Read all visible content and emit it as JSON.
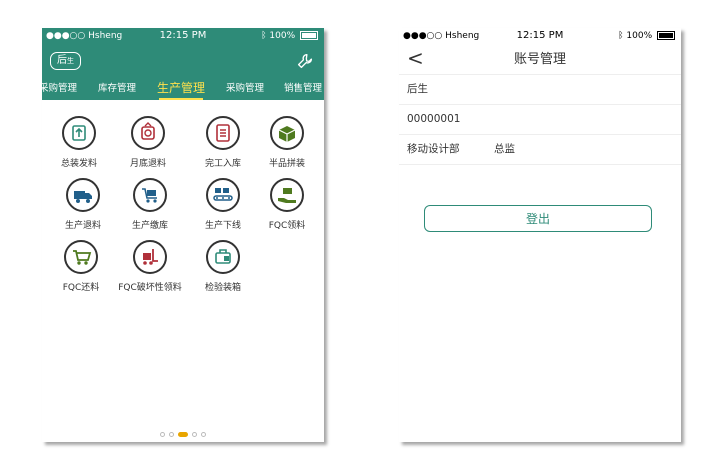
{
  "left": {
    "status": {
      "carrier": "●●●○○ Hsheng",
      "time": "12:15 PM",
      "battery": "100%"
    },
    "user_pill": {
      "main": "后",
      "sub": "生"
    },
    "tabs": [
      "采购管理",
      "库存管理",
      "生产管理",
      "采购管理",
      "销售管理"
    ],
    "active_tab": "生产管理",
    "grid": [
      {
        "label": "总装发料",
        "icon": "upload-box-icon"
      },
      {
        "label": "月底退料",
        "icon": "return-material-icon"
      },
      {
        "label": "完工入库",
        "icon": "clipboard-list-icon"
      },
      {
        "label": "半品拼装",
        "icon": "open-box-icon"
      },
      {
        "label": "生产退料",
        "icon": "truck-icon"
      },
      {
        "label": "生产缴库",
        "icon": "cart-icon"
      },
      {
        "label": "生产下线",
        "icon": "conveyor-icon"
      },
      {
        "label": "FQC领料",
        "icon": "hand-receive-icon"
      },
      {
        "label": "FQC还料",
        "icon": "cart-return-icon"
      },
      {
        "label": "FQC破坏性领料",
        "icon": "forklift-icon"
      },
      {
        "label": "检验装箱",
        "icon": "package-check-icon"
      }
    ],
    "pager": {
      "count": 5,
      "active": 2
    }
  },
  "right": {
    "status": {
      "carrier": "●●●○○ Hsheng",
      "time": "12:15 PM",
      "battery": "100%"
    },
    "title": "账号管理",
    "name": "后生",
    "id": "00000001",
    "department": "移动设计部",
    "position": "总监",
    "logout_label": "登出"
  },
  "colors": {
    "brand": "#2e8b78",
    "accent": "#ffe14d",
    "pager_active": "#e8a500"
  }
}
